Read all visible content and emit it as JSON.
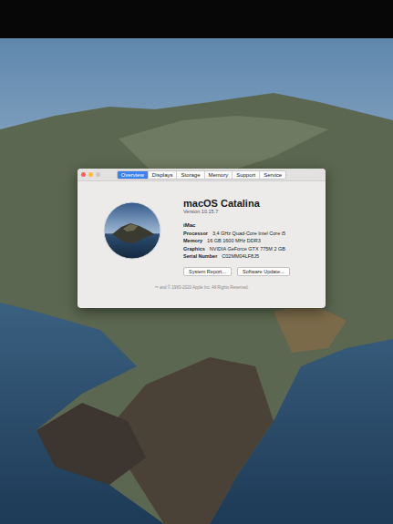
{
  "tabs": [
    {
      "label": "Overview",
      "selected": true
    },
    {
      "label": "Displays",
      "selected": false
    },
    {
      "label": "Storage",
      "selected": false
    },
    {
      "label": "Memory",
      "selected": false
    },
    {
      "label": "Support",
      "selected": false
    },
    {
      "label": "Service",
      "selected": false
    }
  ],
  "os": {
    "name": "macOS Catalina",
    "version": "Version 10.15.7"
  },
  "model": "iMac",
  "specs": [
    {
      "label": "Processor",
      "value": "3,4 GHz Quad-Core Intel Core i5"
    },
    {
      "label": "Memory",
      "value": "16 GB 1600 MHz DDR3"
    },
    {
      "label": "Graphics",
      "value": "NVIDIA GeForce GTX 775M 2 GB"
    },
    {
      "label": "Serial Number",
      "value": "C02MM04LF8J5"
    }
  ],
  "buttons": [
    "System Report...",
    "Software Update..."
  ],
  "footer": "™ and © 1983-2020 Apple Inc. All Rights Reserved."
}
